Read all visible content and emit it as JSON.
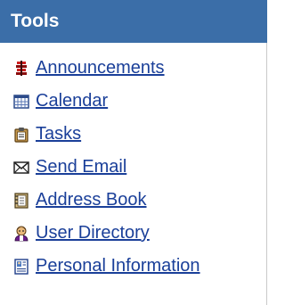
{
  "panel": {
    "title": "Tools",
    "header_color": "#3b6ea8",
    "link_color": "#1a3f99",
    "items": [
      {
        "label": "Announcements",
        "icon": "announcement-icon"
      },
      {
        "label": "Calendar",
        "icon": "calendar-icon"
      },
      {
        "label": "Tasks",
        "icon": "clipboard-icon"
      },
      {
        "label": "Send Email",
        "icon": "envelope-icon"
      },
      {
        "label": "Address Book",
        "icon": "address-book-icon"
      },
      {
        "label": "User Directory",
        "icon": "user-directory-icon"
      },
      {
        "label": "Personal Information",
        "icon": "id-card-icon"
      }
    ]
  }
}
